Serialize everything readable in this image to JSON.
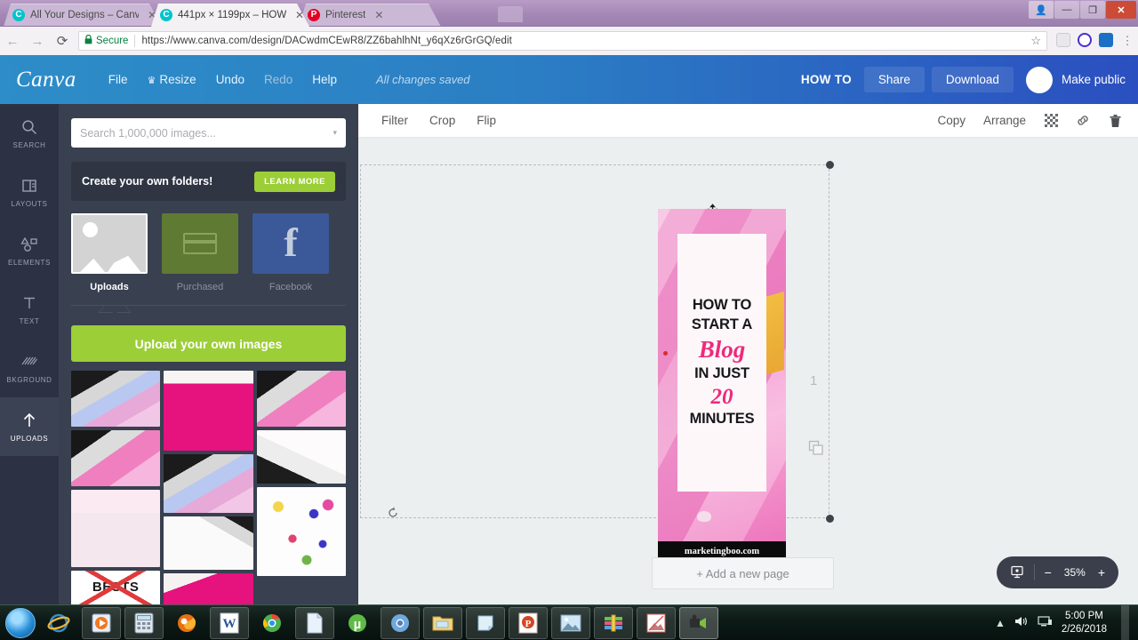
{
  "browser": {
    "tabs": [
      {
        "title": "All Your Designs – Canva",
        "favicon": "canva-icon",
        "active": false
      },
      {
        "title": "441px × 1199px – HOW",
        "favicon": "canva-icon",
        "active": true
      },
      {
        "title": "Pinterest",
        "favicon": "pinterest-icon",
        "active": false
      }
    ],
    "tab_close_glyph": "✕",
    "window_controls": {
      "user": "👤",
      "minimize": "—",
      "maximize": "❐",
      "close": "✕"
    },
    "nav": {
      "back": "←",
      "forward": "→",
      "reload": "⟳"
    },
    "address": {
      "lock_glyph": "🔒",
      "secure_label": "Secure",
      "url": "https://www.canva.com/design/DACwdmCEwR8/ZZ6bahlhNt_y6qXz6rGrGQ/edit",
      "star_glyph": "☆"
    }
  },
  "canva_header": {
    "logo": "Canva",
    "menu": [
      {
        "label": "File",
        "dim": false,
        "crown": false
      },
      {
        "label": "Resize",
        "dim": false,
        "crown": true
      },
      {
        "label": "Undo",
        "dim": false,
        "crown": false
      },
      {
        "label": "Redo",
        "dim": true,
        "crown": false
      },
      {
        "label": "Help",
        "dim": false,
        "crown": false
      }
    ],
    "crown_glyph": "♛",
    "save_status": "All changes saved",
    "doc_title": "HOW TO",
    "share_label": "Share",
    "download_label": "Download",
    "make_public_label": "Make public"
  },
  "rail": {
    "items": [
      {
        "label": "SEARCH",
        "icon": "search-icon",
        "active": false
      },
      {
        "label": "LAYOUTS",
        "icon": "layouts-icon",
        "active": false
      },
      {
        "label": "ELEMENTS",
        "icon": "elements-icon",
        "active": false
      },
      {
        "label": "TEXT",
        "icon": "text-icon",
        "active": false
      },
      {
        "label": "BKGROUND",
        "icon": "background-icon",
        "active": false
      },
      {
        "label": "UPLOADS",
        "icon": "upload-arrow-icon",
        "active": true
      }
    ]
  },
  "panel": {
    "search_placeholder": "Search 1,000,000 images...",
    "dropdown_glyph": "▾",
    "promo_text": "Create your own folders!",
    "promo_button": "LEARN MORE",
    "sources": [
      {
        "label": "Uploads",
        "selected": true
      },
      {
        "label": "Purchased",
        "selected": false
      },
      {
        "label": "Facebook",
        "selected": false
      }
    ],
    "upload_button": "Upload your own images",
    "thumbnails": [
      {
        "name": "laptop-blue-swirl"
      },
      {
        "name": "pink-dress-earrings"
      },
      {
        "name": "laptop-pink-swirl"
      },
      {
        "name": "laptop-pink-swirl-2"
      },
      {
        "name": "laptop-blue-swirl-2"
      },
      {
        "name": "notebook-keyboard"
      },
      {
        "name": "pink-flowers-notebook"
      },
      {
        "name": "sketch-notebook"
      },
      {
        "name": "scattered-petals"
      },
      {
        "name": "bests-card"
      },
      {
        "name": "pink-dress-2"
      }
    ],
    "bests_word": "BESTS"
  },
  "canvas_toolbar": {
    "left": [
      {
        "label": "Filter"
      },
      {
        "label": "Crop"
      },
      {
        "label": "Flip"
      }
    ],
    "right": [
      {
        "label": "Copy",
        "icon": null
      },
      {
        "label": "Arrange",
        "icon": null
      }
    ],
    "icons": [
      {
        "name": "transparency-icon"
      },
      {
        "name": "link-icon"
      },
      {
        "name": "trash-icon"
      }
    ]
  },
  "design": {
    "lines": [
      {
        "text": "HOW TO",
        "style": "bold"
      },
      {
        "text": "START A",
        "style": "bold"
      },
      {
        "text": "Blog",
        "style": "script"
      },
      {
        "text": "IN JUST",
        "style": "bold"
      },
      {
        "text": "20",
        "style": "number"
      },
      {
        "text": "MINUTES",
        "style": "bold"
      }
    ],
    "footer_url": "marketingboo.com",
    "accent_color": "#ee2a7b",
    "background_color": "#f08ccd"
  },
  "stage": {
    "page_number": "1",
    "duplicate_icon": "duplicate-page-icon",
    "rotate_icon": "rotate-handle-icon",
    "move_icon": "move-cursor-icon",
    "add_page_label": "+ Add a new page"
  },
  "zoom_control": {
    "present_icon": "presentation-icon",
    "minus": "−",
    "level": "35%",
    "plus": "+"
  },
  "taskbar": {
    "start_icon": "windows-start-icon",
    "items": [
      {
        "name": "internet-explorer-icon"
      },
      {
        "name": "media-player-icon"
      },
      {
        "name": "calculator-icon"
      },
      {
        "name": "firefox-icon"
      },
      {
        "name": "word-icon"
      },
      {
        "name": "chrome-icon"
      },
      {
        "name": "document-icon"
      },
      {
        "name": "utorrent-icon"
      },
      {
        "name": "chromium-icon"
      },
      {
        "name": "file-explorer-icon"
      },
      {
        "name": "sticky-note-icon"
      },
      {
        "name": "powerpoint-icon"
      },
      {
        "name": "photo-viewer-icon"
      },
      {
        "name": "winrar-icon"
      },
      {
        "name": "broken-image-icon"
      },
      {
        "name": "screen-recorder-icon"
      }
    ],
    "tray": {
      "expand": "▲",
      "volume_icon": "volume-icon",
      "network_icon": "network-icon",
      "time": "5:00 PM",
      "date": "2/26/2018"
    }
  }
}
